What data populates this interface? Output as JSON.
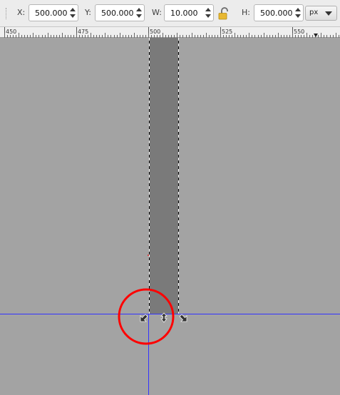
{
  "toolbar": {
    "x_label": "X:",
    "x_value": "500.000",
    "y_label": "Y:",
    "y_value": "500.000",
    "w_label": "W:",
    "w_value": "10.000",
    "h_label": "H:",
    "h_value": "500.000",
    "unit": "px",
    "chain_lock_icon": "open-padlock-icon",
    "lock_color": "#e8b832"
  },
  "ruler": {
    "labels": [
      "450",
      "475",
      "500",
      "525",
      "550"
    ]
  },
  "canvas": {
    "background_color": "#a3a3a3",
    "selection_fill_color": "#7a7a7a",
    "guide_color": "#3333ff",
    "highlight_circle_color": "#ff0000",
    "handle_icons": [
      "resize-diagonal-sw-icon",
      "resize-vertical-icon",
      "resize-diagonal-se-icon"
    ]
  }
}
